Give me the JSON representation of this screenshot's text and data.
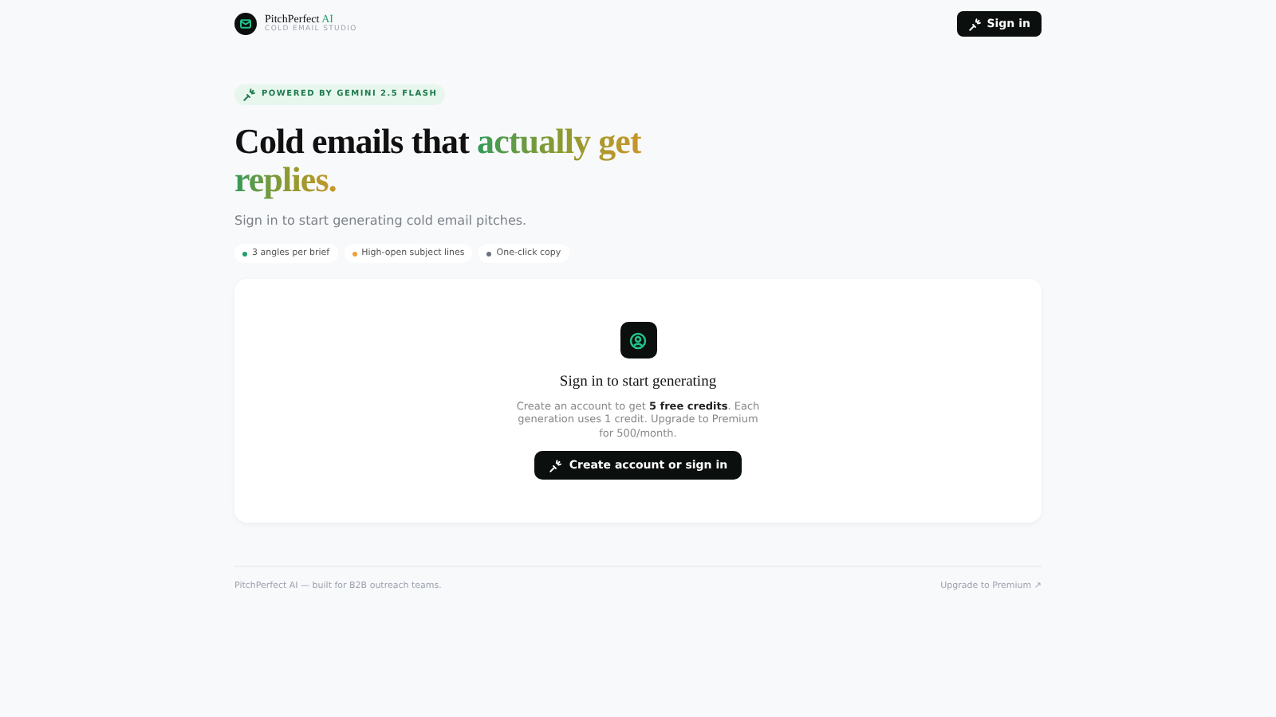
{
  "brand": {
    "name": "PitchPerfect",
    "name_accent": "AI",
    "tagline": "COLD EMAIL STUDIO"
  },
  "header_button": "Sign in",
  "badge": "POWERED BY GEMINI 2.5 FLASH",
  "headline": {
    "lead": "Cold emails that",
    "highlight": "actually get replies."
  },
  "subtitle": "Sign in to start generating cold email pitches.",
  "features": [
    {
      "label": "3 angles per brief",
      "color": "#22a06b"
    },
    {
      "label": "High-open subject lines",
      "color": "#f0a23a"
    },
    {
      "label": "One-click copy",
      "color": "#6b7280"
    }
  ],
  "card": {
    "title": "Sign in to start generating",
    "text": "Create an account to get **5 free credits**. Each generation uses 1 credit. Upgrade to Premium for 500/month.",
    "button": "Create account or sign in"
  },
  "footer": {
    "text": "PitchPerfect AI — built for B2B outreach teams.",
    "link": "Upgrade to Premium ↗"
  }
}
